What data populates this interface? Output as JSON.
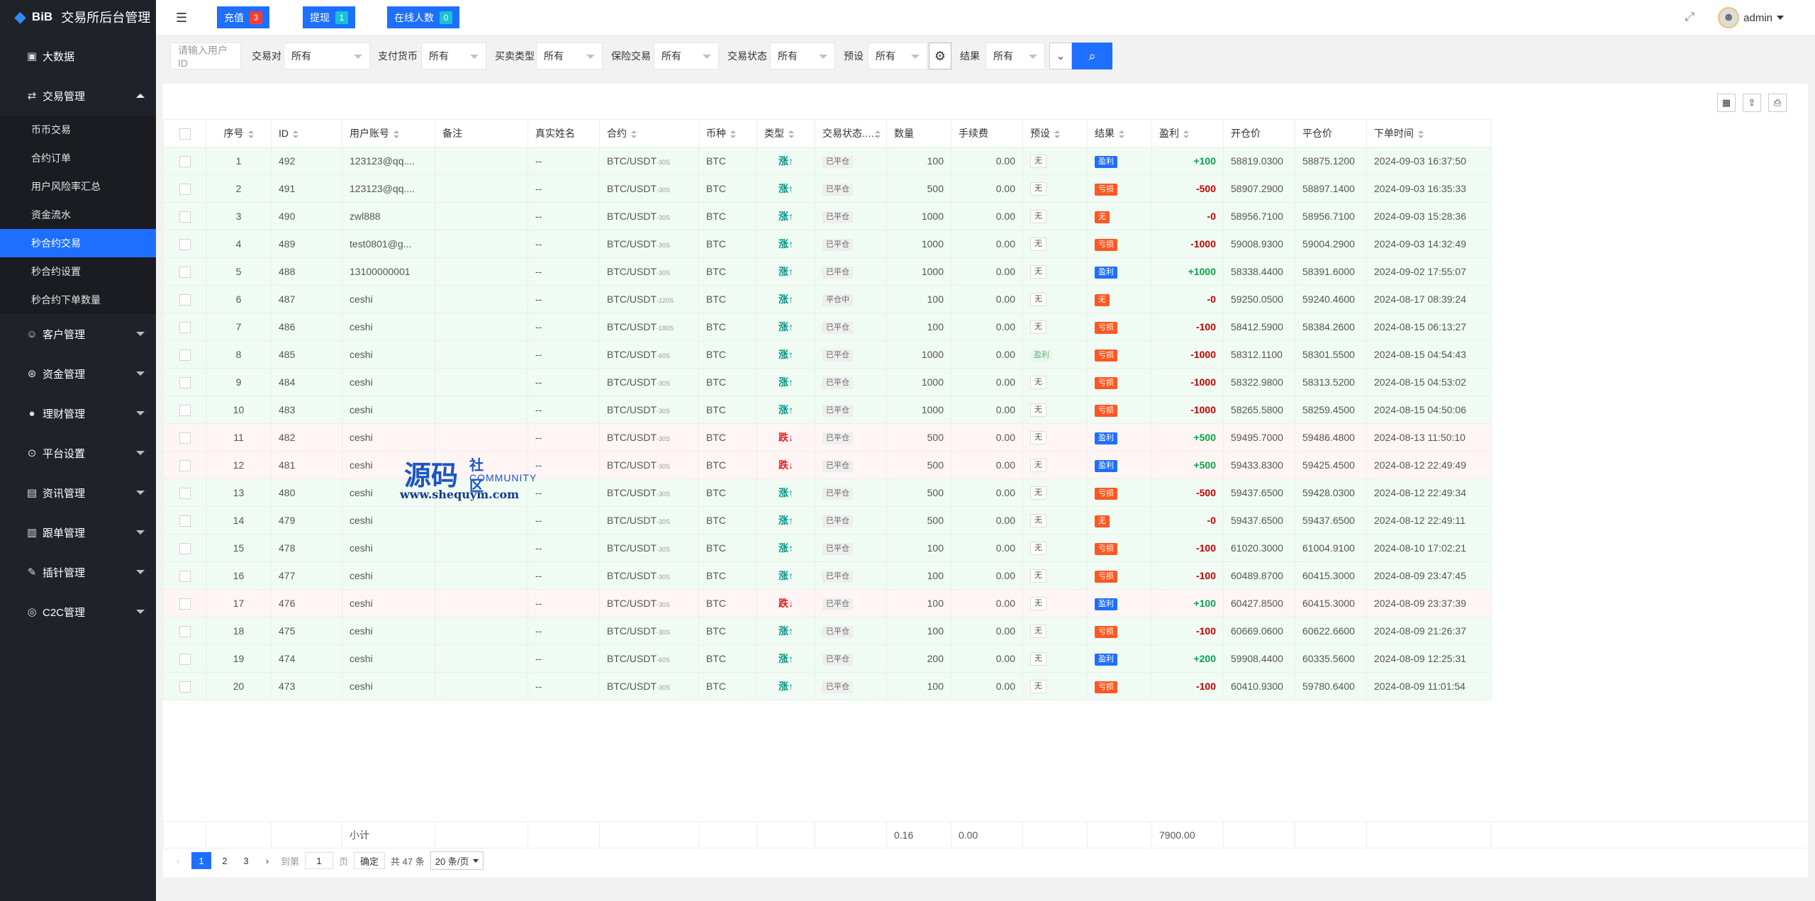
{
  "app": {
    "brand": "BiB",
    "title": "交易所后台管理"
  },
  "colors": {
    "accent": "#1e6fff",
    "sidebar": "#20222a",
    "badge_red": "#ff3b30",
    "badge_cyan": "#17c3d3",
    "up_green": "#009688",
    "down_red": "#e02020"
  },
  "sidebar": {
    "dashboard": "大数据",
    "trade_menu": "交易管理",
    "trade_sub": [
      "币币交易",
      "合约订单",
      "用户风险率汇总",
      "资金流水",
      "秒合约交易",
      "秒合约设置",
      "秒合约下单数量"
    ],
    "menus": [
      "客户管理",
      "资金管理",
      "理财管理",
      "平台设置",
      "资讯管理",
      "跟单管理",
      "插针管理",
      "C2C管理"
    ]
  },
  "topbar": {
    "recharge_label": "充值",
    "recharge_count": "3",
    "withdraw_label": "提现",
    "withdraw_count": "1",
    "online_label": "在线人数",
    "online_count": "0",
    "user": "admin"
  },
  "filters": {
    "user_id_placeholder": "请输入用户ID",
    "pair_label": "交易对",
    "pair_value": "所有",
    "pay_label": "支付货币",
    "pay_value": "所有",
    "side_label": "买卖类型",
    "side_value": "所有",
    "insure_label": "保险交易",
    "insure_value": "所有",
    "status_label": "交易状态",
    "status_value": "所有",
    "preset_label": "预设",
    "preset_value": "所有",
    "result_label": "结果",
    "result_value": "所有"
  },
  "table": {
    "headers": [
      "序号",
      "ID",
      "用户账号",
      "备注",
      "真实姓名",
      "合约",
      "币种",
      "类型",
      "交易状态...",
      "数量",
      "手续费",
      "预设",
      "结果",
      "盈利",
      "开仓价",
      "平仓价",
      "下单时间"
    ],
    "rows": [
      {
        "no": "1",
        "id": "492",
        "acct": "123123@qq....",
        "pair": "BTC/USDT",
        "p": "-30S",
        "coin": "BTC",
        "type": "up",
        "typeText": "涨↑",
        "status": "已平仓",
        "qty": "100",
        "fee": "0.00",
        "preset": "无",
        "presetType": "plain",
        "result": "盈利",
        "resultType": "blue",
        "profit": "+100",
        "open": "58819.0300",
        "close": "58875.1200",
        "time": "2024-09-03 16:37:50"
      },
      {
        "no": "2",
        "id": "491",
        "acct": "123123@qq....",
        "pair": "BTC/USDT",
        "p": "-30S",
        "coin": "BTC",
        "type": "up",
        "typeText": "涨↑",
        "status": "已平仓",
        "qty": "500",
        "fee": "0.00",
        "preset": "无",
        "presetType": "plain",
        "result": "亏损",
        "resultType": "red",
        "profit": "-500",
        "open": "58907.2900",
        "close": "58897.1400",
        "time": "2024-09-03 16:35:33"
      },
      {
        "no": "3",
        "id": "490",
        "acct": "zwl888",
        "pair": "BTC/USDT",
        "p": "-30S",
        "coin": "BTC",
        "type": "up",
        "typeText": "涨↑",
        "status": "已平仓",
        "qty": "1000",
        "fee": "0.00",
        "preset": "无",
        "presetType": "plain",
        "result": "无",
        "resultType": "red",
        "profit": "-0",
        "open": "58956.7100",
        "close": "58956.7100",
        "time": "2024-09-03 15:28:36"
      },
      {
        "no": "4",
        "id": "489",
        "acct": "test0801@g...",
        "pair": "BTC/USDT",
        "p": "-30S",
        "coin": "BTC",
        "type": "up",
        "typeText": "涨↑",
        "status": "已平仓",
        "qty": "1000",
        "fee": "0.00",
        "preset": "无",
        "presetType": "plain",
        "result": "亏损",
        "resultType": "red",
        "profit": "-1000",
        "open": "59008.9300",
        "close": "59004.2900",
        "time": "2024-09-03 14:32:49"
      },
      {
        "no": "5",
        "id": "488",
        "acct": "13100000001",
        "pair": "BTC/USDT",
        "p": "-30S",
        "coin": "BTC",
        "type": "up",
        "typeText": "涨↑",
        "status": "已平仓",
        "qty": "1000",
        "fee": "0.00",
        "preset": "无",
        "presetType": "plain",
        "result": "盈利",
        "resultType": "blue",
        "profit": "+1000",
        "open": "58338.4400",
        "close": "58391.6000",
        "time": "2024-09-02 17:55:07"
      },
      {
        "no": "6",
        "id": "487",
        "acct": "ceshi",
        "pair": "BTC/USDT",
        "p": "-120S",
        "coin": "BTC",
        "type": "up",
        "typeText": "涨↑",
        "status": "平仓中",
        "qty": "100",
        "fee": "0.00",
        "preset": "无",
        "presetType": "plain",
        "result": "无",
        "resultType": "red",
        "profit": "-0",
        "open": "59250.0500",
        "close": "59240.4600",
        "time": "2024-08-17 08:39:24"
      },
      {
        "no": "7",
        "id": "486",
        "acct": "ceshi",
        "pair": "BTC/USDT",
        "p": "-180S",
        "coin": "BTC",
        "type": "up",
        "typeText": "涨↑",
        "status": "已平仓",
        "qty": "100",
        "fee": "0.00",
        "preset": "无",
        "presetType": "plain",
        "result": "亏损",
        "resultType": "red",
        "profit": "-100",
        "open": "58412.5900",
        "close": "58384.2600",
        "time": "2024-08-15 06:13:27"
      },
      {
        "no": "8",
        "id": "485",
        "acct": "ceshi",
        "pair": "BTC/USDT",
        "p": "-60S",
        "coin": "BTC",
        "type": "up",
        "typeText": "涨↑",
        "status": "已平仓",
        "qty": "1000",
        "fee": "0.00",
        "preset": "盈利",
        "presetType": "greentxt",
        "result": "亏损",
        "resultType": "red",
        "profit": "-1000",
        "open": "58312.1100",
        "close": "58301.5500",
        "time": "2024-08-15 04:54:43"
      },
      {
        "no": "9",
        "id": "484",
        "acct": "ceshi",
        "pair": "BTC/USDT",
        "p": "-30S",
        "coin": "BTC",
        "type": "up",
        "typeText": "涨↑",
        "status": "已平仓",
        "qty": "1000",
        "fee": "0.00",
        "preset": "无",
        "presetType": "plain",
        "result": "亏损",
        "resultType": "red",
        "profit": "-1000",
        "open": "58322.9800",
        "close": "58313.5200",
        "time": "2024-08-15 04:53:02"
      },
      {
        "no": "10",
        "id": "483",
        "acct": "ceshi",
        "pair": "BTC/USDT",
        "p": "-30S",
        "coin": "BTC",
        "type": "up",
        "typeText": "涨↑",
        "status": "已平仓",
        "qty": "1000",
        "fee": "0.00",
        "preset": "无",
        "presetType": "plain",
        "result": "亏损",
        "resultType": "red",
        "profit": "-1000",
        "open": "58265.5800",
        "close": "58259.4500",
        "time": "2024-08-15 04:50:06"
      },
      {
        "no": "11",
        "id": "482",
        "acct": "ceshi",
        "pair": "BTC/USDT",
        "p": "-30S",
        "coin": "BTC",
        "type": "down",
        "typeText": "跌↓",
        "status": "已平仓",
        "qty": "500",
        "fee": "0.00",
        "preset": "无",
        "presetType": "plain",
        "result": "盈利",
        "resultType": "blue",
        "profit": "+500",
        "open": "59495.7000",
        "close": "59486.4800",
        "time": "2024-08-13 11:50:10"
      },
      {
        "no": "12",
        "id": "481",
        "acct": "ceshi",
        "pair": "BTC/USDT",
        "p": "-30S",
        "coin": "BTC",
        "type": "down",
        "typeText": "跌↓",
        "status": "已平仓",
        "qty": "500",
        "fee": "0.00",
        "preset": "无",
        "presetType": "plain",
        "result": "盈利",
        "resultType": "blue",
        "profit": "+500",
        "open": "59433.8300",
        "close": "59425.4500",
        "time": "2024-08-12 22:49:49"
      },
      {
        "no": "13",
        "id": "480",
        "acct": "ceshi",
        "pair": "BTC/USDT",
        "p": "-30S",
        "coin": "BTC",
        "type": "up",
        "typeText": "涨↑",
        "status": "已平仓",
        "qty": "500",
        "fee": "0.00",
        "preset": "无",
        "presetType": "plain",
        "result": "亏损",
        "resultType": "red",
        "profit": "-500",
        "open": "59437.6500",
        "close": "59428.0300",
        "time": "2024-08-12 22:49:34"
      },
      {
        "no": "14",
        "id": "479",
        "acct": "ceshi",
        "pair": "BTC/USDT",
        "p": "-30S",
        "coin": "BTC",
        "type": "up",
        "typeText": "涨↑",
        "status": "已平仓",
        "qty": "500",
        "fee": "0.00",
        "preset": "无",
        "presetType": "plain",
        "result": "无",
        "resultType": "red",
        "profit": "-0",
        "open": "59437.6500",
        "close": "59437.6500",
        "time": "2024-08-12 22:49:11"
      },
      {
        "no": "15",
        "id": "478",
        "acct": "ceshi",
        "pair": "BTC/USDT",
        "p": "-30S",
        "coin": "BTC",
        "type": "up",
        "typeText": "涨↑",
        "status": "已平仓",
        "qty": "100",
        "fee": "0.00",
        "preset": "无",
        "presetType": "plain",
        "result": "亏损",
        "resultType": "red",
        "profit": "-100",
        "open": "61020.3000",
        "close": "61004.9100",
        "time": "2024-08-10 17:02:21"
      },
      {
        "no": "16",
        "id": "477",
        "acct": "ceshi",
        "pair": "BTC/USDT",
        "p": "-30S",
        "coin": "BTC",
        "type": "up",
        "typeText": "涨↑",
        "status": "已平仓",
        "qty": "100",
        "fee": "0.00",
        "preset": "无",
        "presetType": "plain",
        "result": "亏损",
        "resultType": "red",
        "profit": "-100",
        "open": "60489.8700",
        "close": "60415.3000",
        "time": "2024-08-09 23:47:45"
      },
      {
        "no": "17",
        "id": "476",
        "acct": "ceshi",
        "pair": "BTC/USDT",
        "p": "-30S",
        "coin": "BTC",
        "type": "down",
        "typeText": "跌↓",
        "status": "已平仓",
        "qty": "100",
        "fee": "0.00",
        "preset": "无",
        "presetType": "plain",
        "result": "盈利",
        "resultType": "blue",
        "profit": "+100",
        "open": "60427.8500",
        "close": "60415.3000",
        "time": "2024-08-09 23:37:39"
      },
      {
        "no": "18",
        "id": "475",
        "acct": "ceshi",
        "pair": "BTC/USDT",
        "p": "-30S",
        "coin": "BTC",
        "type": "up",
        "typeText": "涨↑",
        "status": "已平仓",
        "qty": "100",
        "fee": "0.00",
        "preset": "无",
        "presetType": "plain",
        "result": "亏损",
        "resultType": "red",
        "profit": "-100",
        "open": "60669.0600",
        "close": "60622.6600",
        "time": "2024-08-09 21:26:37"
      },
      {
        "no": "19",
        "id": "474",
        "acct": "ceshi",
        "pair": "BTC/USDT",
        "p": "-60S",
        "coin": "BTC",
        "type": "up",
        "typeText": "涨↑",
        "status": "已平仓",
        "qty": "200",
        "fee": "0.00",
        "preset": "无",
        "presetType": "plain",
        "result": "盈利",
        "resultType": "blue",
        "profit": "+200",
        "open": "59908.4400",
        "close": "60335.5600",
        "time": "2024-08-09 12:25:31"
      },
      {
        "no": "20",
        "id": "473",
        "acct": "ceshi",
        "pair": "BTC/USDT",
        "p": "-30S",
        "coin": "BTC",
        "type": "up",
        "typeText": "涨↑",
        "status": "已平仓",
        "qty": "100",
        "fee": "0.00",
        "preset": "无",
        "presetType": "plain",
        "result": "亏损",
        "resultType": "red",
        "profit": "-100",
        "open": "60410.9300",
        "close": "59780.6400",
        "time": "2024-08-09 11:01:54"
      }
    ]
  },
  "footer": {
    "subtotal_label": "小计",
    "qty_total": "0.16",
    "fee_total": "0.00",
    "profit_total": "7900.00"
  },
  "pager": {
    "pages": [
      "1",
      "2",
      "3"
    ],
    "goto_label": "到第",
    "goto_value": "1",
    "page_unit": "页",
    "confirm": "确定",
    "total": "共 47 条",
    "size": "20 条/页"
  },
  "watermark": {
    "big": "源码",
    "cn": "社区",
    "en": "COMMUNITY",
    "url": "www.shequym.com"
  }
}
